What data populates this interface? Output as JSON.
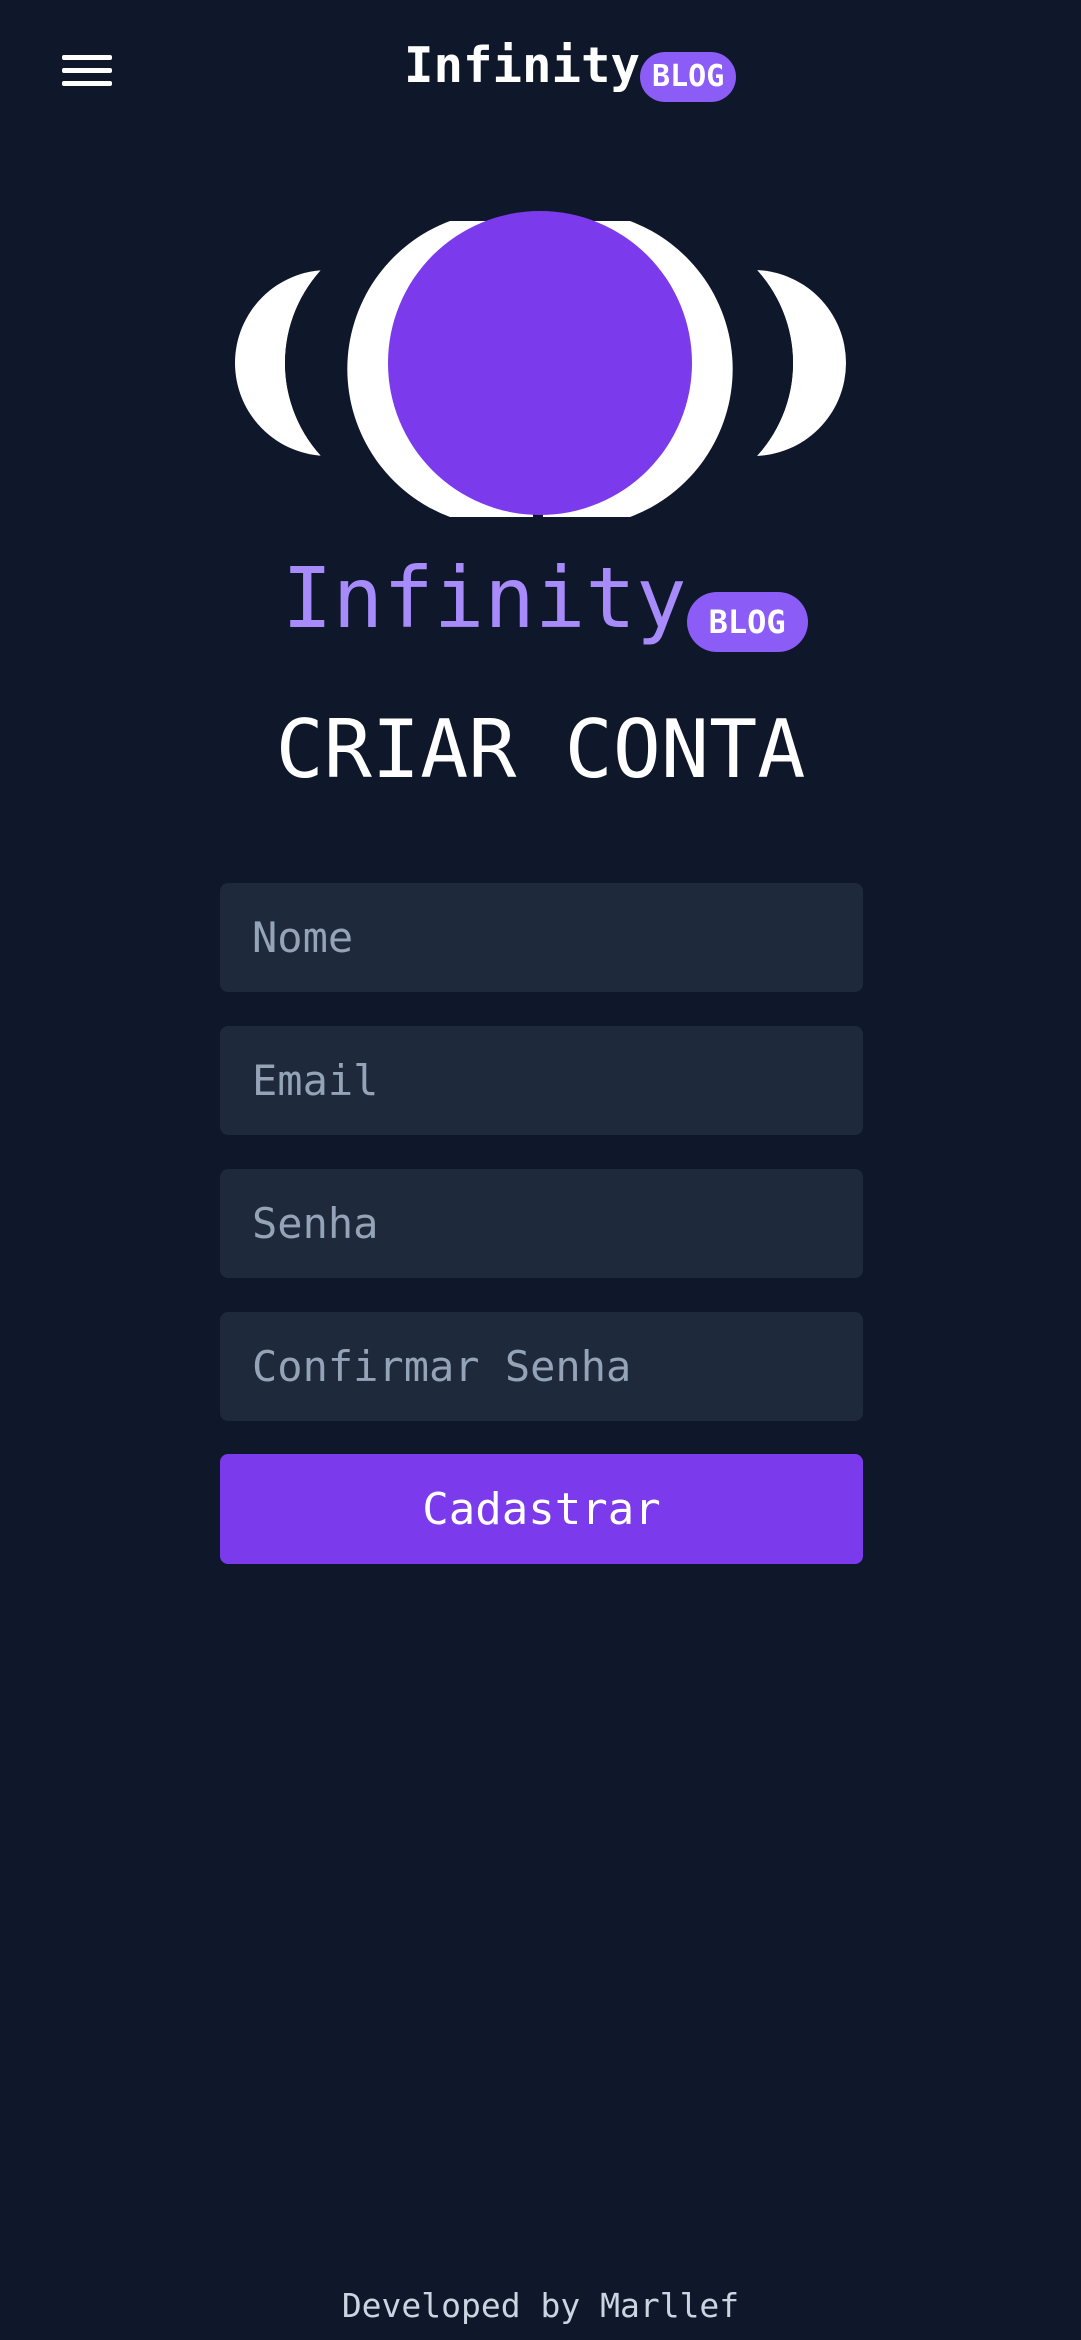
{
  "header": {
    "menu_icon": "hamburger-menu-icon",
    "brand": "Infinity",
    "brand_badge": "BLOG"
  },
  "logo": {
    "icon": "infinity-moons-logo",
    "brand": "Infinity",
    "brand_badge": "BLOG"
  },
  "title": "CRIAR CONTA",
  "form": {
    "name_placeholder": "Nome",
    "email_placeholder": "Email",
    "password_placeholder": "Senha",
    "confirm_password_placeholder": "Confirmar Senha",
    "submit_label": "Cadastrar"
  },
  "footer": {
    "text": "Developed by Marllef"
  },
  "colors": {
    "background": "#0f172a",
    "field_background": "#1e293b",
    "accent": "#7c3aed",
    "badge": "#8b5cf6",
    "brand_light": "#a78bfa",
    "placeholder": "#94a3b8"
  }
}
